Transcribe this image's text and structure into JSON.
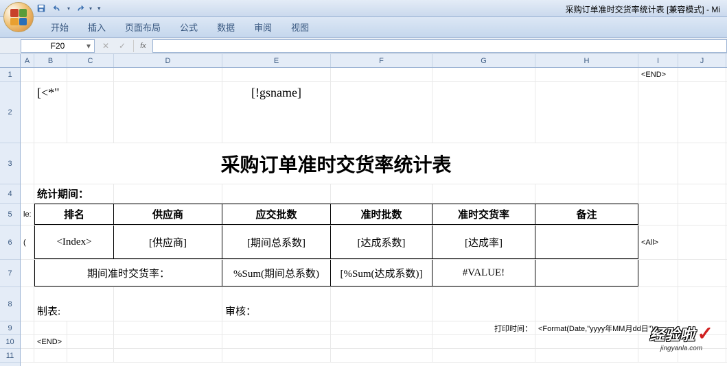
{
  "window": {
    "title": "采购订单准时交货率统计表  [兼容模式] - Mi"
  },
  "ribbon": {
    "tabs": [
      "开始",
      "插入",
      "页面布局",
      "公式",
      "数据",
      "审阅",
      "视图"
    ]
  },
  "formula": {
    "name_box": "F20",
    "fx_label": "fx"
  },
  "columns": [
    "A",
    "B",
    "C",
    "D",
    "E",
    "F",
    "G",
    "H",
    "I",
    "J"
  ],
  "rows": [
    "1",
    "2",
    "3",
    "4",
    "5",
    "6",
    "7",
    "8",
    "9",
    "10",
    "11"
  ],
  "cells": {
    "I1": "<END>",
    "B2": "[<*\"",
    "E2": "[!gsname]",
    "title3": "采购订单准时交货率统计表",
    "B4": "统计期间：",
    "A5": "le:",
    "C5": "排名",
    "D5": "供应商",
    "E5": "应交批数",
    "F5": "准时批数",
    "G5": "准时交货率",
    "H5": "备注",
    "A6": "(",
    "C6": "<Index>",
    "D6": "[供应商]",
    "E6": "[期间总系数]",
    "F6": "[达成系数]",
    "G6": "[达成率]",
    "I6": "<All>",
    "CD7": "期间准时交货率：",
    "E7": "%Sum(期间总系数)",
    "F7": "[%Sum(达成系数)]",
    "G7": "#VALUE!",
    "B8": "制表:",
    "E8": "审核：",
    "G9": "打印时间：",
    "H9": "<Format(Date,\"yyyy年MM月dd日\")>",
    "B10": "<END>"
  },
  "watermark": {
    "main": "经验啦",
    "sub": "jingyanla.com",
    "check": "✓"
  }
}
